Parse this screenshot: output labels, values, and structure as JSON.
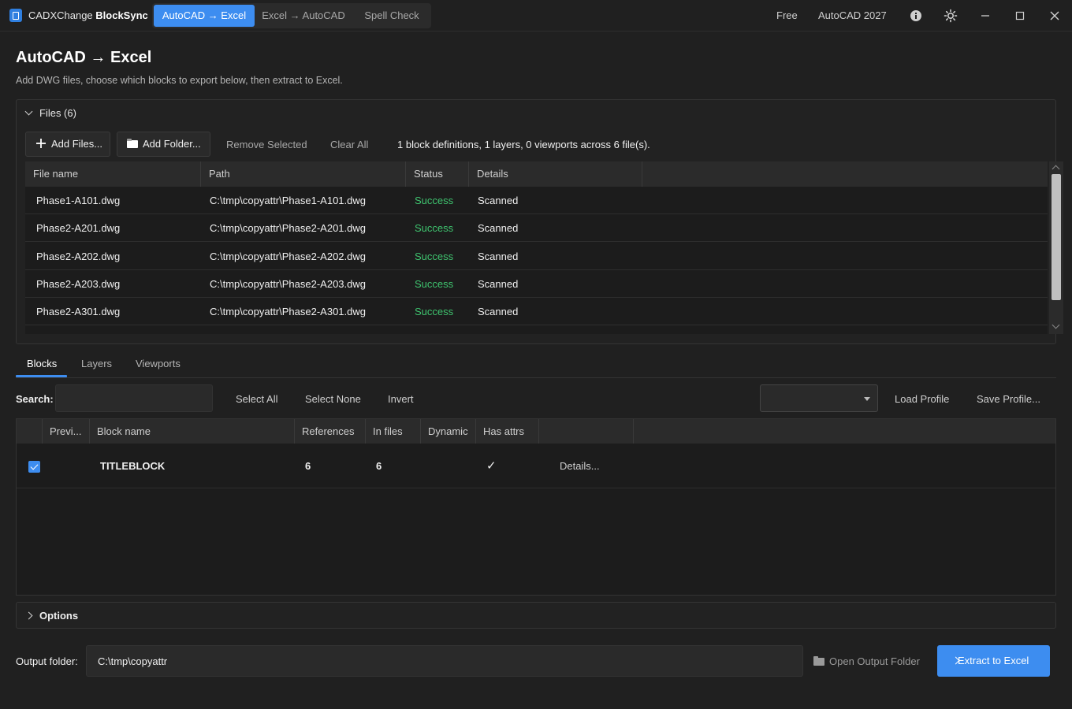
{
  "app": {
    "name_prefix": "CADXChange",
    "name_suffix": " BlockSync",
    "mode_tabs": [
      "AutoCAD → Excel",
      "Excel → AutoCAD",
      "Spell Check"
    ],
    "license": "Free",
    "version": "AutoCAD 2027"
  },
  "page": {
    "title": "AutoCAD → Excel",
    "subtitle": "Add DWG files, choose which blocks to export below, then extract to Excel."
  },
  "files": {
    "header": "Files (6)",
    "add_files": "Add Files...",
    "add_folder": "Add Folder...",
    "remove_selected": "Remove Selected",
    "clear_all": "Clear All",
    "summary": "1 block definitions, 1 layers, 0 viewports across 6 file(s).",
    "columns": [
      "File name",
      "Path",
      "Status",
      "Details"
    ],
    "rows": [
      {
        "name": "Phase1-A101.dwg",
        "path": "C:\\tmp\\copyattr\\Phase1-A101.dwg",
        "status": "Success",
        "details": "Scanned"
      },
      {
        "name": "Phase2-A201.dwg",
        "path": "C:\\tmp\\copyattr\\Phase2-A201.dwg",
        "status": "Success",
        "details": "Scanned"
      },
      {
        "name": "Phase2-A202.dwg",
        "path": "C:\\tmp\\copyattr\\Phase2-A202.dwg",
        "status": "Success",
        "details": "Scanned"
      },
      {
        "name": "Phase2-A203.dwg",
        "path": "C:\\tmp\\copyattr\\Phase2-A203.dwg",
        "status": "Success",
        "details": "Scanned"
      },
      {
        "name": "Phase2-A301.dwg",
        "path": "C:\\tmp\\copyattr\\Phase2-A301.dwg",
        "status": "Success",
        "details": "Scanned"
      }
    ]
  },
  "tabs": [
    "Blocks",
    "Layers",
    "Viewports"
  ],
  "blocks": {
    "search_label": "Search:",
    "search_value": "",
    "select_all": "Select All",
    "select_none": "Select None",
    "invert": "Invert",
    "profile_value": "",
    "load_profile": "Load Profile",
    "save_profile": "Save Profile...",
    "columns": [
      "Previ...",
      "Block name",
      "References",
      "In files",
      "Dynamic",
      "Has attrs"
    ],
    "rows": [
      {
        "checked": true,
        "name": "TITLEBLOCK",
        "references": "6",
        "in_files": "6",
        "dynamic": "",
        "has_attrs": "✓",
        "details": "Details..."
      }
    ]
  },
  "options": {
    "label": "Options"
  },
  "output": {
    "label": "Output folder:",
    "path": "C:\\tmp\\copyattr",
    "open_folder": "Open Output Folder",
    "extract": "Extract to Excel"
  },
  "colors": {
    "accent": "#3d8df0",
    "success": "#3fc46f",
    "background": "#202020"
  }
}
